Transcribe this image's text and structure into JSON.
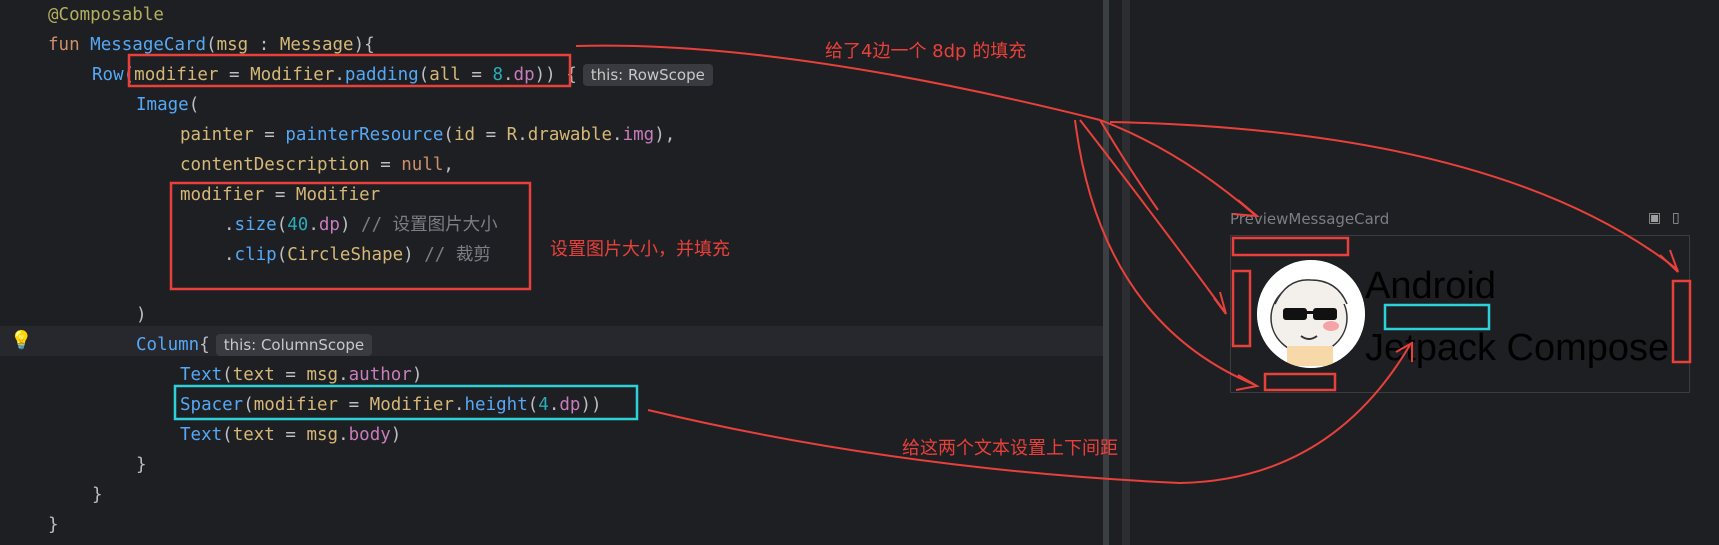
{
  "editor": {
    "lines": [
      {
        "parts": [
          [
            "ann",
            "@Composable"
          ]
        ]
      },
      {
        "parts": [
          [
            "kw",
            "fun "
          ],
          [
            "fn",
            "MessageCard"
          ],
          [
            "paren",
            "("
          ],
          [
            "param",
            "msg"
          ],
          [
            "paren",
            " : "
          ],
          [
            "param",
            "Message"
          ],
          [
            "paren",
            "){"
          ]
        ]
      },
      {
        "parts": [
          [
            "fn",
            "Row"
          ],
          [
            "paren",
            "("
          ],
          [
            "param",
            "modifier"
          ],
          [
            "paren",
            " = "
          ],
          [
            "param",
            "Modifier"
          ],
          [
            "paren",
            "."
          ],
          [
            "fn",
            "padding"
          ],
          [
            "paren",
            "("
          ],
          [
            "param",
            "all"
          ],
          [
            "paren",
            " = "
          ],
          [
            "num",
            "8"
          ],
          [
            "paren",
            "."
          ],
          [
            "prop",
            "dp"
          ],
          [
            "paren",
            ")) {"
          ]
        ],
        "hint": "this: RowScope"
      },
      {
        "parts": [
          [
            "fn",
            "Image"
          ],
          [
            "paren",
            "("
          ]
        ]
      },
      {
        "parts": [
          [
            "param",
            "painter"
          ],
          [
            "paren",
            " = "
          ],
          [
            "fn",
            "painterResource"
          ],
          [
            "paren",
            "("
          ],
          [
            "param",
            "id"
          ],
          [
            "paren",
            " = "
          ],
          [
            "param",
            "R"
          ],
          [
            "paren",
            "."
          ],
          [
            "param",
            "drawable"
          ],
          [
            "paren",
            "."
          ],
          [
            "prop",
            "img"
          ],
          [
            "paren",
            "),"
          ]
        ]
      },
      {
        "parts": [
          [
            "param",
            "contentDescription"
          ],
          [
            "paren",
            " = "
          ],
          [
            "kw",
            "null"
          ],
          [
            "paren",
            ","
          ]
        ]
      },
      {
        "parts": [
          [
            "param",
            "modifier"
          ],
          [
            "paren",
            " = "
          ],
          [
            "param",
            "Modifier"
          ]
        ]
      },
      {
        "parts": [
          [
            "paren",
            "."
          ],
          [
            "fn",
            "size"
          ],
          [
            "paren",
            "("
          ],
          [
            "num",
            "40"
          ],
          [
            "paren",
            "."
          ],
          [
            "prop",
            "dp"
          ],
          [
            "paren",
            ") "
          ],
          [
            "cmt",
            "// 设置图片大小"
          ]
        ]
      },
      {
        "parts": [
          [
            "paren",
            "."
          ],
          [
            "fn",
            "clip"
          ],
          [
            "paren",
            "("
          ],
          [
            "param",
            "CircleShape"
          ],
          [
            "paren",
            ") "
          ],
          [
            "cmt",
            "// 裁剪"
          ]
        ]
      },
      {
        "parts": []
      },
      {
        "parts": [
          [
            "paren",
            ")"
          ]
        ]
      },
      {
        "parts": [
          [
            "fn",
            "Column"
          ],
          [
            "paren",
            "{"
          ]
        ],
        "hint": "this: ColumnScope"
      },
      {
        "parts": [
          [
            "fn",
            "Text"
          ],
          [
            "paren",
            "("
          ],
          [
            "param",
            "text"
          ],
          [
            "paren",
            " = "
          ],
          [
            "param",
            "msg"
          ],
          [
            "paren",
            "."
          ],
          [
            "prop",
            "author"
          ],
          [
            "paren",
            ")"
          ]
        ]
      },
      {
        "parts": [
          [
            "fn",
            "Spacer"
          ],
          [
            "paren",
            "("
          ],
          [
            "param",
            "modifier"
          ],
          [
            "paren",
            " = "
          ],
          [
            "param",
            "Modifier"
          ],
          [
            "paren",
            "."
          ],
          [
            "fn",
            "height"
          ],
          [
            "paren",
            "("
          ],
          [
            "num",
            "4"
          ],
          [
            "paren",
            "."
          ],
          [
            "prop",
            "dp"
          ],
          [
            "paren",
            "))"
          ]
        ]
      },
      {
        "parts": [
          [
            "fn",
            "Text"
          ],
          [
            "paren",
            "("
          ],
          [
            "param",
            "text"
          ],
          [
            "paren",
            " = "
          ],
          [
            "param",
            "msg"
          ],
          [
            "paren",
            "."
          ],
          [
            "prop",
            "body"
          ],
          [
            "paren",
            ")"
          ]
        ]
      },
      {
        "parts": [
          [
            "paren",
            "}"
          ]
        ]
      },
      {
        "parts": [
          [
            "paren",
            "}"
          ]
        ]
      },
      {
        "parts": [
          [
            "paren",
            "}"
          ]
        ]
      }
    ]
  },
  "preview": {
    "title": "PreviewMessageCard",
    "card_author": "Android",
    "card_body": "Jetpack Compose"
  },
  "annotations": {
    "padding_note": "给了4边一个 8dp 的填充",
    "image_note": "设置图片大小，并填充",
    "spacer_note": "给这两个文本设置上下间距"
  },
  "colors": {
    "annotation_red": "#e8403a",
    "annotation_cyan": "#2fd1d8",
    "editor_bg": "#1e1f22"
  }
}
